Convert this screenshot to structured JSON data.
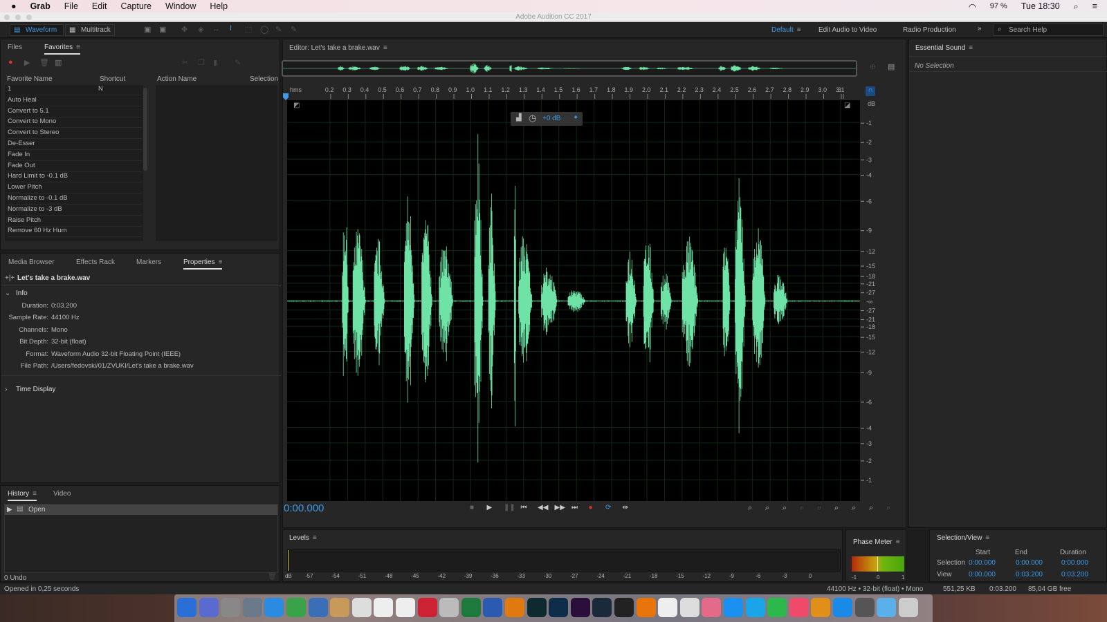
{
  "menubar": {
    "app": "Grab",
    "items": [
      "File",
      "Edit",
      "Capture",
      "Window",
      "Help"
    ],
    "battery": "97 %",
    "clock": "Tue 18:30"
  },
  "window_title": "Adobe Audition CC 2017",
  "toolbar": {
    "waveform": "Waveform",
    "multitrack": "Multitrack",
    "workspaces": [
      "Default",
      "Edit Audio to Video",
      "Radio Production"
    ],
    "more": "»",
    "search_placeholder": "Search Help"
  },
  "favorites_panel": {
    "tabs": [
      "Files",
      "Favorites"
    ],
    "columns": [
      "Favorite Name",
      "Shortcut",
      "Action Name",
      "Selection"
    ],
    "items": [
      {
        "name": "1",
        "shortcut": "N"
      },
      {
        "name": "Auto Heal"
      },
      {
        "name": "Convert to 5.1"
      },
      {
        "name": "Convert to Mono"
      },
      {
        "name": "Convert to Stereo"
      },
      {
        "name": "De-Esser"
      },
      {
        "name": "Fade In"
      },
      {
        "name": "Fade Out"
      },
      {
        "name": "Hard Limit to -0.1 dB"
      },
      {
        "name": "Lower Pitch"
      },
      {
        "name": "Normalize to -0.1 dB"
      },
      {
        "name": "Normalize to -3 dB"
      },
      {
        "name": "Raise Pitch"
      },
      {
        "name": "Remove 60 Hz Hum"
      }
    ]
  },
  "properties_panel": {
    "tabs": [
      "Media Browser",
      "Effects Rack",
      "Markers",
      "Properties"
    ],
    "file": "Let's take a brake.wav",
    "info_label": "Info",
    "info": [
      {
        "k": "Duration:",
        "v": "0:03.200"
      },
      {
        "k": "Sample Rate:",
        "v": "44100 Hz"
      },
      {
        "k": "Channels:",
        "v": "Mono"
      },
      {
        "k": "Bit Depth:",
        "v": "32-bit (float)"
      },
      {
        "k": "Format:",
        "v": "Waveform Audio 32-bit Floating Point (IEEE)"
      },
      {
        "k": "File Path:",
        "v": "/Users/fedovski/01/ZVUKI/Let's take a brake.wav"
      }
    ],
    "time_display": "Time Display"
  },
  "history_panel": {
    "tabs": [
      "History",
      "Video"
    ],
    "items": [
      "Open"
    ],
    "undo": "0 Undo"
  },
  "editor": {
    "title": "Editor: Let's take a brake.wav",
    "ruler": [
      "hms",
      "0.2",
      "0.3",
      "0.4",
      "0.5",
      "0.6",
      "0.7",
      "0.8",
      "0.9",
      "1.0",
      "1.1",
      "1.2",
      "1.3",
      "1.4",
      "1.5",
      "1.6",
      "1.7",
      "1.8",
      "1.9",
      "2.0",
      "2.1",
      "2.2",
      "2.3",
      "2.4",
      "2.5",
      "2.6",
      "2.7",
      "2.8",
      "2.9",
      "3.0",
      "3.1",
      "3"
    ],
    "db_unit": "dB",
    "db_scale": [
      -1,
      -2,
      -3,
      -4,
      -6,
      -9,
      -12,
      -15,
      -18,
      -21,
      -27
    ],
    "db_inf": "-∞",
    "hud_gain": "+0 dB",
    "time": "0:00.000",
    "waveform_color": "#6fe3a6"
  },
  "levels": {
    "title": "Levels",
    "unit": "dB",
    "ticks": [
      "-57",
      "-54",
      "-51",
      "-48",
      "-45",
      "-42",
      "-39",
      "-36",
      "-33",
      "-30",
      "-27",
      "-24",
      "-21",
      "-18",
      "-15",
      "-12",
      "-9",
      "-6",
      "-3",
      "0"
    ]
  },
  "phase_meter": {
    "title": "Phase Meter",
    "ticks": [
      "-1",
      "0",
      "1"
    ]
  },
  "selection_view": {
    "title": "Selection/View",
    "cols": [
      "Start",
      "End",
      "Duration"
    ],
    "selection": {
      "label": "Selection",
      "start": "0:00.000",
      "end": "0:00.000",
      "duration": "0:00.000"
    },
    "view": {
      "label": "View",
      "start": "0:00.000",
      "end": "0:03.200",
      "duration": "0:03.200"
    }
  },
  "essential_sound": {
    "title": "Essential Sound",
    "status": "No Selection"
  },
  "status": {
    "left": "Opened in 0,25 seconds",
    "format": "44100 Hz • 32-bit (float) • Mono",
    "size": "551,25 KB",
    "duration": "0:03.200",
    "free": "85,04 GB free"
  },
  "colors": {
    "accent": "#3d9ae8",
    "waveform": "#6fe3a6",
    "record": "#e03232"
  }
}
